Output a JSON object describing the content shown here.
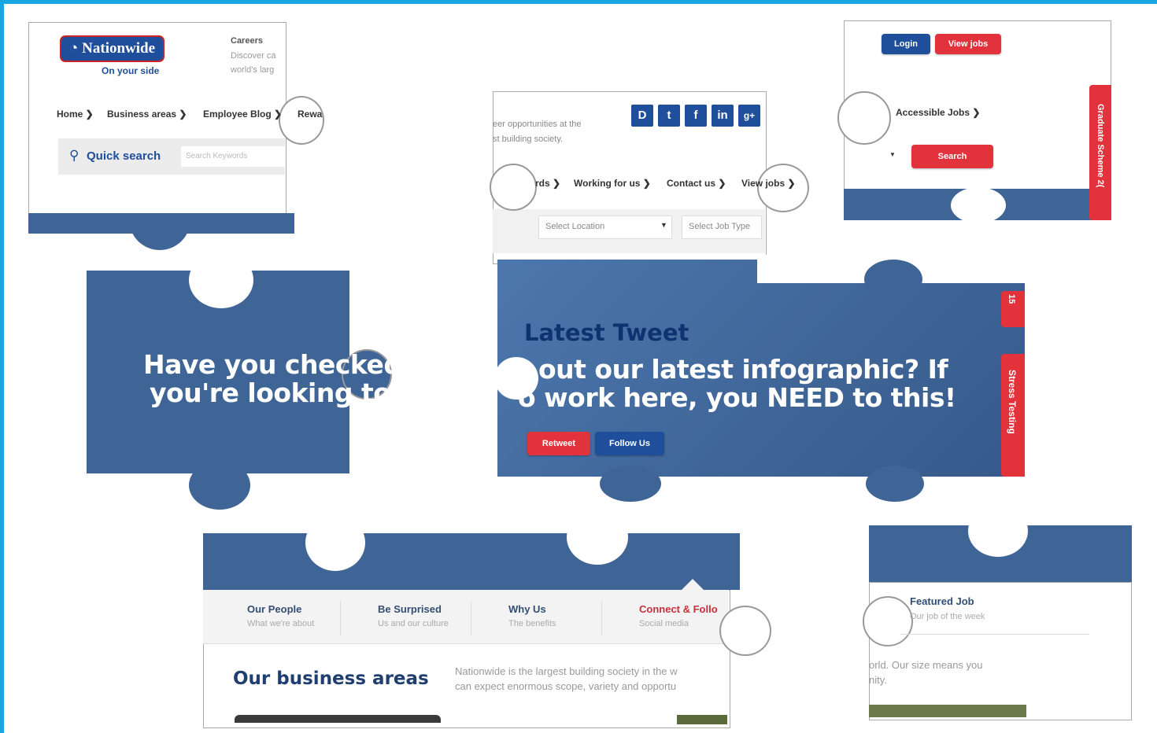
{
  "colors": {
    "frame": "#1aa6e0",
    "brand_blue": "#3f6597",
    "accent_red": "#e2323b",
    "navy": "#1f4f9a"
  },
  "header": {
    "logo_text": "Nationwide",
    "tagline": "On your side",
    "careers_title": "Careers",
    "careers_line1": "Discover ca",
    "careers_line2": "world's larg"
  },
  "nav": [
    "Home",
    "Business areas",
    "Employee Blog",
    "Rewa"
  ],
  "quick_search": {
    "label": "Quick search",
    "placeholder": "Search Keywords"
  },
  "center_top": {
    "line1": "eer opportunities at the",
    "line2": "st building society.",
    "social": [
      "D",
      "t",
      "f",
      "in",
      "g+"
    ],
    "nav": [
      "rds",
      "Working for us",
      "Contact us",
      "View jobs"
    ],
    "location_select": "Select Location",
    "jobtype_select": "Select Job Type"
  },
  "top_right": {
    "login": "Login",
    "view_jobs": "View jobs",
    "accessible": "Accessible Jobs",
    "search_btn": "Search",
    "side_tab": "Graduate Scheme 2("
  },
  "promo": {
    "line1": "Have you checked o",
    "line2": "you're looking to w"
  },
  "tweet": {
    "heading": "Latest Tweet",
    "line1": "out our latest infographic? If",
    "line2": "o work here, you NEED to this!",
    "retweet": "Retweet",
    "follow": "Follow Us",
    "side_tab1": "15",
    "side_tab2": "Stress Testing"
  },
  "tabs": [
    {
      "title": "Our People",
      "sub": "What we're about"
    },
    {
      "title": "Be Surprised",
      "sub": "Us and our culture"
    },
    {
      "title": "Why Us",
      "sub": "The benefits"
    },
    {
      "title": "Connect & Follo",
      "sub": "Social media"
    }
  ],
  "business": {
    "heading": "Our business areas",
    "line1": "Nationwide is the largest building society in the w",
    "line2": "can expect enormous scope, variety and opportu"
  },
  "featured": {
    "title": "Featured Job",
    "sub": "Our job of the week",
    "line1": "orld. Our size means you",
    "line2": "nity."
  }
}
